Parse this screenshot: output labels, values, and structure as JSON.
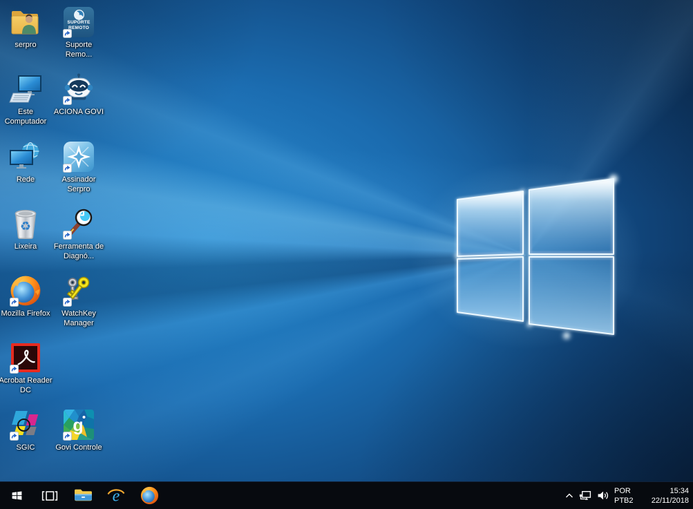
{
  "wallpaper": {
    "name": "Windows 10 hero wallpaper",
    "base_blue": "#1b6cb0",
    "dark_navy": "#081c38",
    "glow_cyan": "#bfe6ff"
  },
  "desktop": {
    "icons": [
      {
        "name": "serpro",
        "label": "serpro",
        "shortcut": false
      },
      {
        "name": "suporte-remoto",
        "label": "Suporte Remo...",
        "shortcut": true,
        "icon_text1": "SUPORTE",
        "icon_text2": "REMOTO"
      },
      {
        "name": "este-computador",
        "label": "Este Computador",
        "shortcut": false
      },
      {
        "name": "aciona-govi",
        "label": "ACIONA GOVI",
        "shortcut": true
      },
      {
        "name": "rede",
        "label": "Rede",
        "shortcut": false
      },
      {
        "name": "assinador-serpro",
        "label": "Assinador Serpro",
        "shortcut": true
      },
      {
        "name": "lixeira",
        "label": "Lixeira",
        "shortcut": false
      },
      {
        "name": "ferramenta-diagnostico",
        "label": "Ferramenta de Diagnó...",
        "shortcut": true
      },
      {
        "name": "mozilla-firefox",
        "label": "Mozilla Firefox",
        "shortcut": true
      },
      {
        "name": "watchkey-manager",
        "label": "WatchKey Manager",
        "shortcut": true
      },
      {
        "name": "acrobat-reader-dc",
        "label": "Acrobat Reader DC",
        "shortcut": true
      },
      {
        "name": "sgic",
        "label": "SGIC",
        "shortcut": true
      },
      {
        "name": "govi-controle",
        "label": "Govi Controle",
        "shortcut": true,
        "icon_letter": "g"
      }
    ]
  },
  "taskbar": {
    "buttons": [
      {
        "name": "start"
      },
      {
        "name": "task-view"
      },
      {
        "name": "file-explorer"
      },
      {
        "name": "internet-explorer"
      },
      {
        "name": "mozilla-firefox"
      }
    ],
    "tray": {
      "language": {
        "line1": "POR",
        "line2": "PTB2"
      },
      "clock": {
        "time": "15:34",
        "date": "22/11/2018"
      }
    }
  }
}
